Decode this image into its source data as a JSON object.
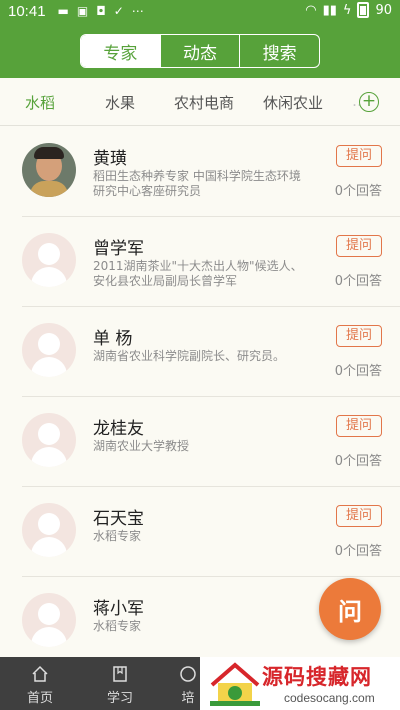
{
  "status": {
    "time": "10:41",
    "battery": "90"
  },
  "header": {
    "tabs": [
      "专家",
      "动态",
      "搜索"
    ],
    "active_tab": 0
  },
  "categories": [
    "水稻",
    "水果",
    "农村电商",
    "休闲农业"
  ],
  "experts": [
    {
      "name": "黄璜",
      "desc": "稻田生态种养专家 中国科学院生态环境研究中心客座研究员",
      "ask_label": "提问",
      "answers": "0个回答"
    },
    {
      "name": "曾学军",
      "desc": "2011湖南茶业\"十大杰出人物\"候选人、安化县农业局副局长曾学军",
      "ask_label": "提问",
      "answers": "0个回答"
    },
    {
      "name": "单 杨",
      "desc": "湖南省农业科学院副院长、研究员。",
      "ask_label": "提问",
      "answers": "0个回答"
    },
    {
      "name": "龙桂友",
      "desc": "湖南农业大学教授",
      "ask_label": "提问",
      "answers": "0个回答"
    },
    {
      "name": "石天宝",
      "desc": "水稻专家",
      "ask_label": "提问",
      "answers": "0个回答"
    },
    {
      "name": "蒋小军",
      "desc": "水稻专家",
      "ask_label": "",
      "answers": ""
    }
  ],
  "fab_label": "问",
  "bottom_nav": [
    "首页",
    "学习",
    "培"
  ],
  "watermark": {
    "title": "源码搜藏网",
    "url": "codesocang.com"
  },
  "colors": {
    "brand_green": "#57a23a",
    "accent_orange": "#ec7a3a"
  }
}
